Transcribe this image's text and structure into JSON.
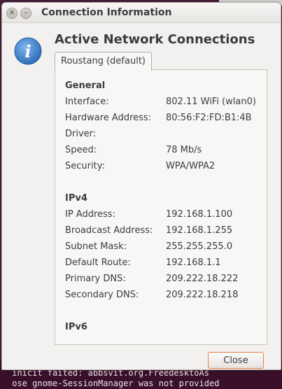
{
  "window": {
    "title": "Connection Information",
    "heading": "Active Network Connections",
    "tab_label": "Roustang (default)"
  },
  "general": {
    "title": "General",
    "rows": [
      {
        "label": "Interface:",
        "value": "802.11 WiFi (wlan0)"
      },
      {
        "label": "Hardware Address:",
        "value": "80:56:F2:FD:B1:4B"
      },
      {
        "label": "Driver:",
        "value": ""
      },
      {
        "label": "Speed:",
        "value": "78 Mb/s"
      },
      {
        "label": "Security:",
        "value": "WPA/WPA2"
      }
    ]
  },
  "ipv4": {
    "title": "IPv4",
    "rows": [
      {
        "label": "IP Address:",
        "value": "192.168.1.100"
      },
      {
        "label": "Broadcast Address:",
        "value": "192.168.1.255"
      },
      {
        "label": "Subnet Mask:",
        "value": "255.255.255.0"
      },
      {
        "label": "Default Route:",
        "value": "192.168.1.1"
      },
      {
        "label": "Primary DNS:",
        "value": "209.222.18.222"
      },
      {
        "label": "Secondary DNS:",
        "value": "209.222.18.218"
      }
    ]
  },
  "ipv6": {
    "title": "IPv6"
  },
  "buttons": {
    "close_label": "Close"
  },
  "terminal": {
    "line1": " inicit faited: abbsvit.org.FreedesktoAs",
    "line2": " ose gnome-SessionManager was not provided"
  },
  "colors": {
    "info_icon": "#2f78c8",
    "close_button_border": "#e67a4c"
  }
}
